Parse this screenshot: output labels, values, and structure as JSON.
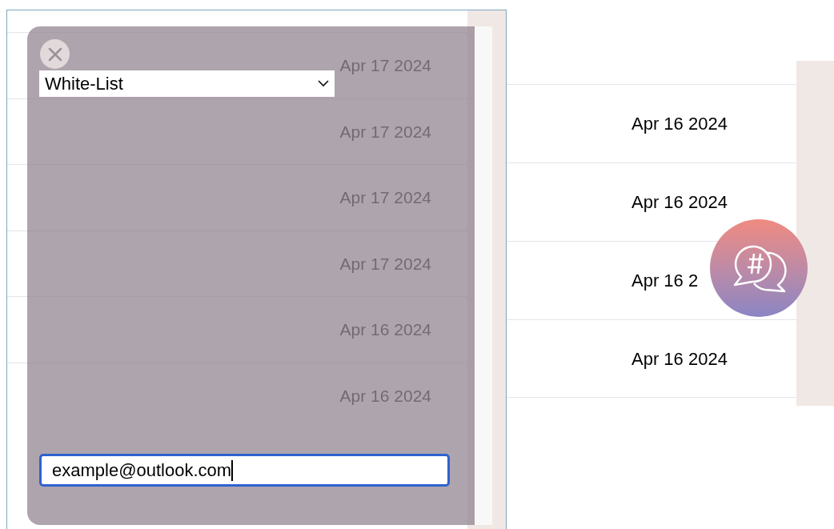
{
  "list_panel": {
    "rows": [
      {
        "date": "Apr 17 2024"
      },
      {
        "date": "Apr 17 2024"
      },
      {
        "date": "Apr 17 2024"
      },
      {
        "date": "Apr 17 2024"
      },
      {
        "date": "Apr 16 2024"
      },
      {
        "date": "Apr 16 2024"
      }
    ]
  },
  "dialog": {
    "list_select": {
      "value": "White-List"
    },
    "email_field": {
      "value": "example@outlook.com",
      "focused": true
    }
  },
  "table": {
    "rows": [
      {
        "date": "Apr 16 2024"
      },
      {
        "date": "Apr 16 2024"
      },
      {
        "date": "Apr 16 2"
      },
      {
        "date": "Apr 16 2024"
      }
    ]
  }
}
